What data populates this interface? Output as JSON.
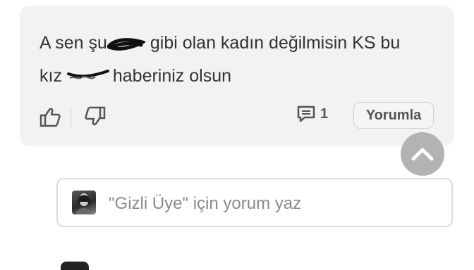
{
  "comment": {
    "text_part1": "A sen şu",
    "text_part2": "gibi olan kadın değilmisin KS bu",
    "text_part3": "kız",
    "text_part4": "haberiniz olsun"
  },
  "actions": {
    "reply_count": "1",
    "yorumla_label": "Yorumla"
  },
  "reply_box": {
    "placeholder": "\"Gizli Üye\" için yorum yaz"
  },
  "colors": {
    "card_bg": "#f2f2f2",
    "scroll_button": "#b3b3b3",
    "text": "#333333"
  },
  "icons": [
    "thumbs-up-icon",
    "thumbs-down-icon",
    "comment-icon",
    "chevron-up-icon"
  ]
}
